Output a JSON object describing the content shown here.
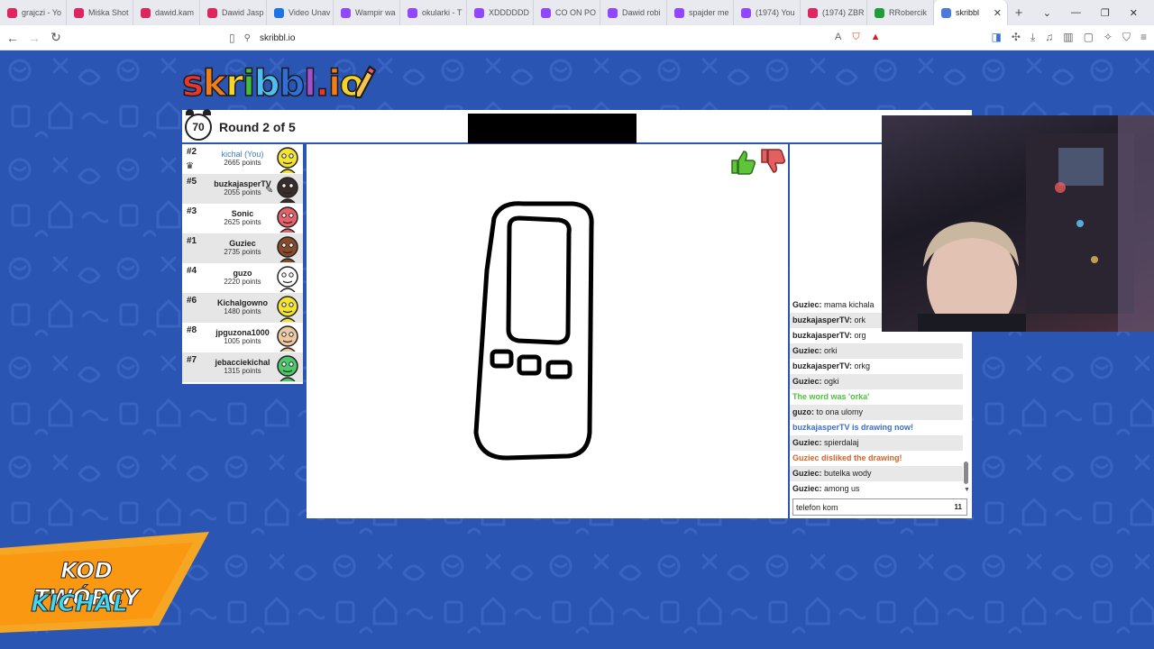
{
  "browser": {
    "tabs": [
      {
        "label": "grajczi - Yo",
        "color": "#e0245e"
      },
      {
        "label": "Miśka Shot",
        "color": "#e0245e"
      },
      {
        "label": "dawid.kam",
        "color": "#e0245e"
      },
      {
        "label": "Dawid Jasp",
        "color": "#e0245e"
      },
      {
        "label": "Video Unav",
        "color": "#1a73e8"
      },
      {
        "label": "Wampir wa",
        "color": "#9146ff"
      },
      {
        "label": "okularki - T",
        "color": "#9146ff"
      },
      {
        "label": "XDDDDDD",
        "color": "#9146ff"
      },
      {
        "label": "CO ON PO",
        "color": "#9146ff"
      },
      {
        "label": "Dawid robi",
        "color": "#9146ff"
      },
      {
        "label": "spajder me",
        "color": "#9146ff"
      },
      {
        "label": "(1974) You",
        "color": "#9146ff"
      },
      {
        "label": "(1974) ZBR",
        "color": "#e0245e"
      },
      {
        "label": "RRobercik",
        "color": "#1f9d3a"
      }
    ],
    "active_tab": {
      "label": "skribbl",
      "close": "✕"
    },
    "new_tab": "+",
    "url": "skribbl.io"
  },
  "game": {
    "logo": {
      "letters": [
        {
          "ch": "s",
          "color": "#e8372a"
        },
        {
          "ch": "k",
          "color": "#f07c1a"
        },
        {
          "ch": "r",
          "color": "#f5d427"
        },
        {
          "ch": "i",
          "color": "#3fbf3a"
        },
        {
          "ch": "b",
          "color": "#4ec0f0"
        },
        {
          "ch": "b",
          "color": "#2f6fd8"
        },
        {
          "ch": "l",
          "color": "#a44fd1"
        },
        {
          "ch": ".",
          "color": "#e8372a"
        },
        {
          "ch": "i",
          "color": "#f07c1a"
        },
        {
          "ch": "o",
          "color": "#f5d427"
        }
      ]
    },
    "timer": "70",
    "round": "Round 2 of 5",
    "players": [
      {
        "rank": "#2",
        "name": "kichal (You)",
        "points": "2665 points",
        "me": true,
        "color": "#f5e52a",
        "crown": true
      },
      {
        "rank": "#5",
        "name": "buzkajasperTV",
        "points": "2055 points",
        "color": "#3a2c2c",
        "drawing": true
      },
      {
        "rank": "#3",
        "name": "Sonic",
        "points": "2625 points",
        "color": "#e8606a"
      },
      {
        "rank": "#1",
        "name": "Guziec",
        "points": "2735 points",
        "color": "#8a4a2a"
      },
      {
        "rank": "#4",
        "name": "guzo",
        "points": "2220 points",
        "color": "#ffffff"
      },
      {
        "rank": "#6",
        "name": "Kichalgowno",
        "points": "1480 points",
        "color": "#f5e52a"
      },
      {
        "rank": "#8",
        "name": "jpguzona1000",
        "points": "1005 points",
        "color": "#f0c8a0"
      },
      {
        "rank": "#7",
        "name": "jebacciekichal",
        "points": "1315 points",
        "color": "#4ec96a"
      }
    ],
    "chat": [
      {
        "user": "Guziec",
        "text": "mama kichala"
      },
      {
        "user": "buzkajasperTV",
        "text": "ork"
      },
      {
        "user": "buzkajasperTV",
        "text": "org"
      },
      {
        "user": "Guziec",
        "text": "orki"
      },
      {
        "user": "buzkajasperTV",
        "text": "orkg"
      },
      {
        "user": "Guziec",
        "text": "ogki"
      },
      {
        "system": "The word was 'orka'",
        "kind": "green"
      },
      {
        "user": "guzo",
        "text": "to ona ulomy"
      },
      {
        "system": "buzkajasperTV is drawing now!",
        "kind": "blue"
      },
      {
        "user": "Guziec",
        "text": "spierdalaj"
      },
      {
        "system": "Guziec disliked the drawing!",
        "kind": "orange"
      },
      {
        "user": "Guziec",
        "text": "butelka wody"
      },
      {
        "user": "Guziec",
        "text": "among us"
      }
    ],
    "chat_input": {
      "value": "telefon kom",
      "char_count": "11"
    }
  },
  "promo": {
    "line1": "KOD TWÓRCY",
    "line2": "KICHAL"
  }
}
